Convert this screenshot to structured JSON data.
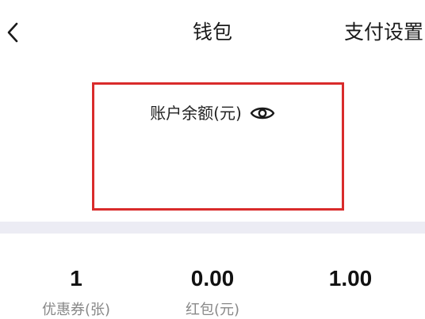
{
  "header": {
    "title": "钱包",
    "right_action": "支付设置",
    "back_icon": "chevron-left-icon"
  },
  "balance": {
    "label": "账户余额(元)",
    "visibility_icon": "eye-icon",
    "highlight_color": "#d92b2b"
  },
  "stats": [
    {
      "value": "1",
      "label": "优惠券(张)"
    },
    {
      "value": "0.00",
      "label": "红包(元)"
    },
    {
      "value": "1.00",
      "label": ""
    }
  ]
}
